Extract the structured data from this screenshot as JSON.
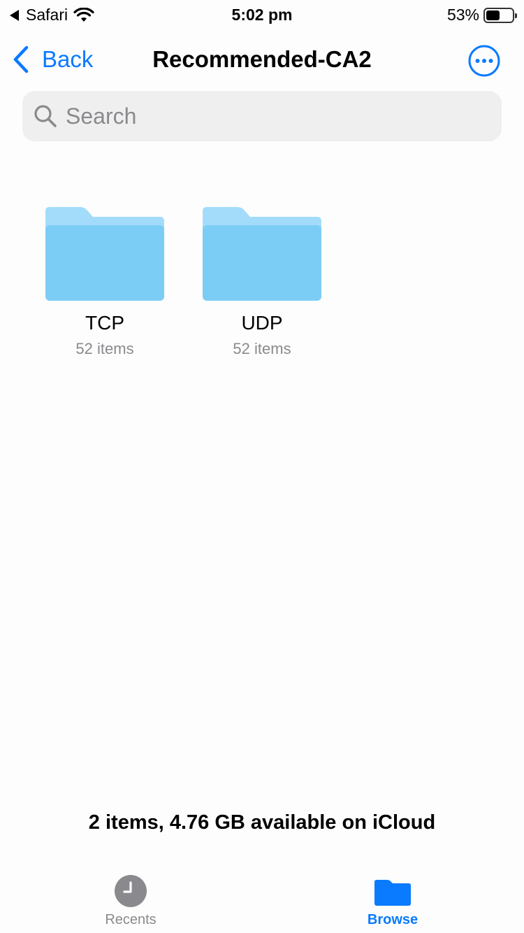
{
  "status_bar": {
    "app_name": "Safari",
    "time": "5:02 pm",
    "battery_percent": "53%",
    "battery_level": 0.53
  },
  "nav": {
    "back_label": "Back",
    "title": "Recommended-CA2",
    "more_icon": "ellipsis-circle-icon"
  },
  "search": {
    "placeholder": "Search",
    "value": ""
  },
  "folders": [
    {
      "name": "TCP",
      "count": "52 items"
    },
    {
      "name": "UDP",
      "count": "52 items"
    }
  ],
  "footer": {
    "storage_text": "2 items, 4.76 GB available on iCloud"
  },
  "tab_bar": {
    "tabs": [
      {
        "label": "Recents",
        "icon": "clock-icon",
        "selected": false
      },
      {
        "label": "Browse",
        "icon": "folder-icon",
        "selected": true
      }
    ]
  },
  "colors": {
    "accent": "#0a7aff",
    "folder_back": "#a3dcfb",
    "folder_front": "#7ccdf6",
    "secondary_text": "#8a8a8e"
  }
}
